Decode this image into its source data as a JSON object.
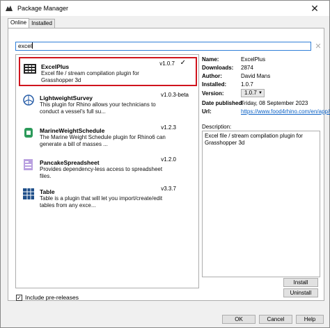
{
  "window": {
    "title": "Package Manager",
    "close_glyph": "✕"
  },
  "tabs": [
    {
      "label": "Online"
    },
    {
      "label": "Installed"
    }
  ],
  "search": {
    "value": "excel",
    "clear_glyph": "✕"
  },
  "packages": [
    {
      "name": "ExcelPlus",
      "description": "Excel file / stream compilation plugin for Grasshopper 3d",
      "version": "v1.0.7",
      "installed_mark": "✓"
    },
    {
      "name": "LightweightSurvey",
      "description": "This plugin for Rhino allows your technicians to conduct a vessel's full su...",
      "version": "v1.0.3-beta"
    },
    {
      "name": "MarineWeightSchedule",
      "description": "The Marine Weight Schedule plugin for Rhino6 can generate a bill of masses ...",
      "version": "v1.2.3"
    },
    {
      "name": "PancakeSpreadsheet",
      "description": "Provides dependency-less access to spreadsheet files.",
      "version": "v1.2.0"
    },
    {
      "name": "Table",
      "description": "Table is a plugin that will let you import/create/edit tables from any exce...",
      "version": "v3.3.7"
    }
  ],
  "details": {
    "name_label": "Name:",
    "name_value": "ExcelPlus",
    "downloads_label": "Downloads:",
    "downloads_value": "2874",
    "author_label": "Author:",
    "author_value": "David Mans",
    "installed_label": "Installed:",
    "installed_value": "1.0.7",
    "version_label": "Version:",
    "version_value": "1.0.7",
    "date_label": "Date published:",
    "date_value": "Friday, 08 September 2023",
    "url_label": "Url:",
    "url_value": "https://www.food4rhino.com/en/app/excel",
    "description_label": "Description:",
    "description_value": "Excel file / stream compilation plugin for Grasshopper 3d"
  },
  "buttons": {
    "install": "Install",
    "uninstall": "Uninstall",
    "ok": "OK",
    "cancel": "Cancel",
    "help": "Help"
  },
  "include_prereleases": {
    "label": "Include pre-releases",
    "checked": true,
    "check_glyph": "✓"
  },
  "colors": {
    "accent": "#2f7ed8",
    "selection_border": "#d0141d",
    "link": "#0a60c5"
  }
}
